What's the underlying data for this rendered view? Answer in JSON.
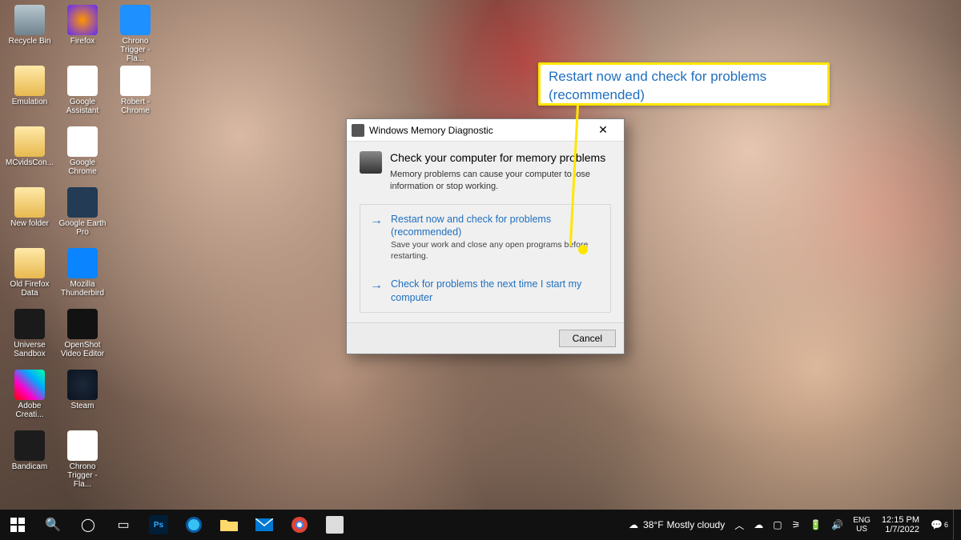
{
  "desktop": {
    "icons": [
      {
        "label": "Recycle Bin",
        "cls": "ic-bin"
      },
      {
        "label": "Emulation",
        "cls": "ic-fold"
      },
      {
        "label": "MCvidsCon...",
        "cls": "ic-fold"
      },
      {
        "label": "New folder",
        "cls": "ic-fold"
      },
      {
        "label": "Old Firefox Data",
        "cls": "ic-fold"
      },
      {
        "label": "Universe Sandbox",
        "cls": "ic-us"
      },
      {
        "label": "Adobe Creati...",
        "cls": "ic-ac"
      },
      {
        "label": "Bandicam",
        "cls": "ic-band"
      },
      {
        "label": "Firefox",
        "cls": "ic-ff"
      },
      {
        "label": "Google Assistant",
        "cls": "ic-ga"
      },
      {
        "label": "Google Chrome",
        "cls": "ic-gc"
      },
      {
        "label": "Google Earth Pro",
        "cls": "ic-ge"
      },
      {
        "label": "Mozilla Thunderbird",
        "cls": "ic-tb"
      },
      {
        "label": "OpenShot Video Editor",
        "cls": "ic-os"
      },
      {
        "label": "Steam",
        "cls": "ic-steam"
      },
      {
        "label": "Chrono Trigger - Fla...",
        "cls": "ic-doc"
      },
      {
        "label": "Chrono Trigger - Fla...",
        "cls": "ic-z"
      },
      {
        "label": "Robert - Chrome",
        "cls": "ic-gc"
      }
    ]
  },
  "dialog": {
    "title": "Windows Memory Diagnostic",
    "heading": "Check your computer for memory problems",
    "subheading": "Memory problems can cause your computer to lose information or stop working.",
    "option1": {
      "title": "Restart now and check for problems (recommended)",
      "sub": "Save your work and close any open programs before restarting."
    },
    "option2": {
      "title": "Check for problems the next time I start my computer"
    },
    "cancel": "Cancel"
  },
  "callout": {
    "text": "Restart now and check for problems (recommended)"
  },
  "taskbar": {
    "weather": {
      "temp": "38°F",
      "desc": "Mostly cloudy"
    },
    "lang": {
      "l1": "ENG",
      "l2": "US"
    },
    "clock": {
      "time": "12:15 PM",
      "date": "1/7/2022"
    },
    "notif_count": "6"
  }
}
